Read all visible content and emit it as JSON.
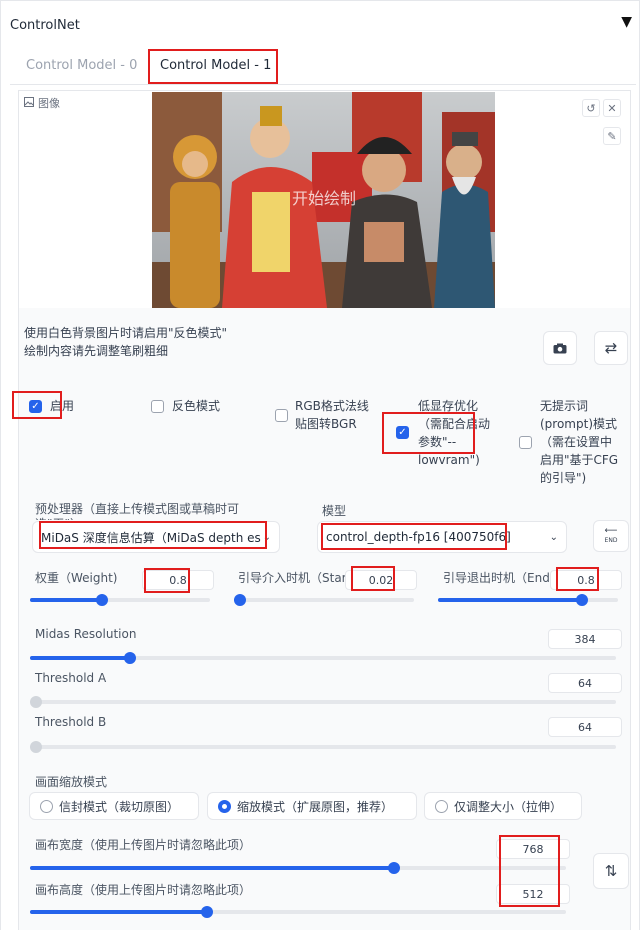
{
  "header": {
    "title": "ControlNet",
    "caret": "▼"
  },
  "tabs": [
    {
      "label": "Control Model - 0",
      "active": false
    },
    {
      "label": "Control Model - 1",
      "active": true
    }
  ],
  "image_panel": {
    "label": "图像",
    "watermark": "开始绘制",
    "hint_line1": "使用白色背景图片时请启用\"反色模式\"",
    "hint_line2": "绘制内容请先调整笔刷粗细"
  },
  "checkboxes": {
    "enable": {
      "label": "启用",
      "checked": true
    },
    "invert": {
      "label": "反色模式",
      "checked": false
    },
    "rgb_line1": "RGB格式法线",
    "rgb_line2": "贴图转BGR",
    "lowvram_lines": [
      "低显存优化",
      "（需配合启动",
      "参数\"--",
      "lowvram\")"
    ],
    "guess_lines": [
      "无提示词",
      "(prompt)模式",
      "（需在设置中",
      "启用\"基于CFG",
      "的引导\")"
    ]
  },
  "preprocessor": {
    "label": "预处理器（直接上传模式图或草稿时可选\"无\"）",
    "value": "MiDaS 深度信息估算（MiDaS depth es"
  },
  "model": {
    "label": "模型",
    "value": "control_depth-fp16 [400750f6]"
  },
  "sliders": {
    "weight": {
      "label": "权重（Weight)",
      "value": "0.8",
      "fraction": 0.4
    },
    "start": {
      "label": "引导介入时机（Start",
      "value": "0.02",
      "fraction": 0.02
    },
    "end": {
      "label": "引导退出时机（End",
      "value": "0.8",
      "fraction": 0.8
    },
    "midas": {
      "label": "Midas Resolution",
      "value": "384",
      "fraction": 0.17
    },
    "threshold_a": {
      "label": "Threshold A",
      "value": "64",
      "fraction": 0
    },
    "threshold_b": {
      "label": "Threshold B",
      "value": "64",
      "fraction": 0
    }
  },
  "resize": {
    "label": "画面缩放模式",
    "options": [
      {
        "label": "信封模式（裁切原图）",
        "selected": false
      },
      {
        "label": "缩放模式（扩展原图，推荐）",
        "selected": true
      },
      {
        "label": "仅调整大小（拉伸）",
        "selected": false
      }
    ]
  },
  "canvas": {
    "width": {
      "label": "画布宽度（使用上传图片时请忽略此项）",
      "value": "768",
      "fraction": 0.68
    },
    "height": {
      "label": "画布高度（使用上传图片时请忽略此项）",
      "value": "512",
      "fraction": 0.33
    }
  },
  "icons": {
    "image": "image-icon",
    "undo": "undo-icon",
    "close": "close-icon",
    "brush": "brush-icon",
    "camera": "camera-icon",
    "swap": "swap-icon",
    "send": "send-end-icon",
    "swap_vertical": "swap-vertical-icon"
  }
}
